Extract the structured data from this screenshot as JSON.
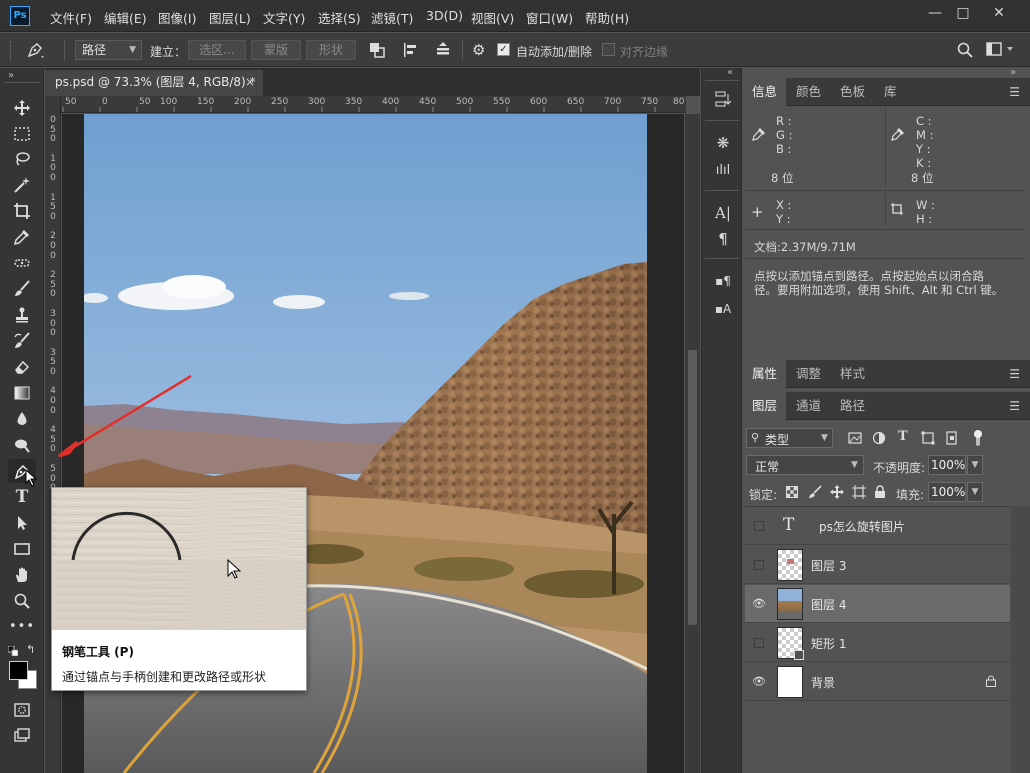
{
  "app": {
    "logo": "Ps"
  },
  "menu": [
    "文件(F)",
    "编辑(E)",
    "图像(I)",
    "图层(L)",
    "文字(Y)",
    "选择(S)",
    "滤镜(T)",
    "3D(D)",
    "视图(V)",
    "窗口(W)",
    "帮助(H)"
  ],
  "window_controls": {
    "minimize": "—",
    "restore": "□",
    "close": "✕"
  },
  "options": {
    "mode": "路径",
    "make_label": "建立：",
    "selection_btn": "选区...",
    "mask_btn": "蒙版",
    "shape_btn": "形状",
    "auto_add_delete": "自动添加/删除",
    "align_edges": "对齐边缘"
  },
  "document": {
    "tab_title": "ps.psd @ 73.3% (图层 4, RGB/8) *",
    "close_glyph": "×",
    "ruler_top": [
      "50",
      "0",
      "50",
      "100",
      "150",
      "200",
      "250",
      "300",
      "350",
      "400",
      "450",
      "500",
      "550",
      "600",
      "650",
      "700",
      "750",
      "80"
    ],
    "ruler_left": [
      "0",
      "5",
      "0",
      "1",
      "0",
      "0",
      "1",
      "5",
      "0",
      "2",
      "0",
      "0",
      "2",
      "5",
      "0",
      "3",
      "0",
      "0",
      "3",
      "5",
      "0",
      "4",
      "0",
      "0",
      "4",
      "5",
      "0",
      "5",
      "0",
      "0"
    ]
  },
  "tooltip": {
    "title": "钢笔工具 (P)",
    "description": "通过锚点与手柄创建和更改路径或形状"
  },
  "info_panel": {
    "tabs": [
      "信息",
      "颜色",
      "色板",
      "库"
    ],
    "rgb_labels": [
      "R :",
      "G :",
      "B :"
    ],
    "cmyk_labels": [
      "C :",
      "M :",
      "Y :",
      "K :"
    ],
    "bit_depth_left": "8 位",
    "bit_depth_right": "8 位",
    "xy_labels": [
      "X :",
      "Y :"
    ],
    "wh_labels": [
      "W :",
      "H :"
    ],
    "doc_size": "文档:2.37M/9.71M",
    "hint_line1": "点按以添加锚点到路径。点按起始点以闭合路",
    "hint_line2": "径。要用附加选项，使用 Shift、Alt 和 Ctrl 键。"
  },
  "properties_panel": {
    "tabs": [
      "属性",
      "调整",
      "样式"
    ]
  },
  "layers_panel": {
    "tabs": [
      "图层",
      "通道",
      "路径"
    ],
    "filter_kind": "类型",
    "blend_mode": "正常",
    "opacity_label": "不透明度:",
    "opacity_value": "100%",
    "lock_label": "锁定:",
    "fill_label": "填充:",
    "fill_value": "100%",
    "layers": [
      {
        "name": "ps怎么旋转图片",
        "kind": "text",
        "visible": false
      },
      {
        "name": "图层 3",
        "kind": "pixel",
        "visible": false
      },
      {
        "name": "图层 4",
        "kind": "photo",
        "visible": true,
        "selected": true
      },
      {
        "name": "矩形 1",
        "kind": "shape",
        "visible": false
      },
      {
        "name": "背景",
        "kind": "background",
        "visible": true,
        "locked": true
      }
    ]
  },
  "colors": {
    "accent": "#31a8ff",
    "arrow": "#e0302a"
  }
}
